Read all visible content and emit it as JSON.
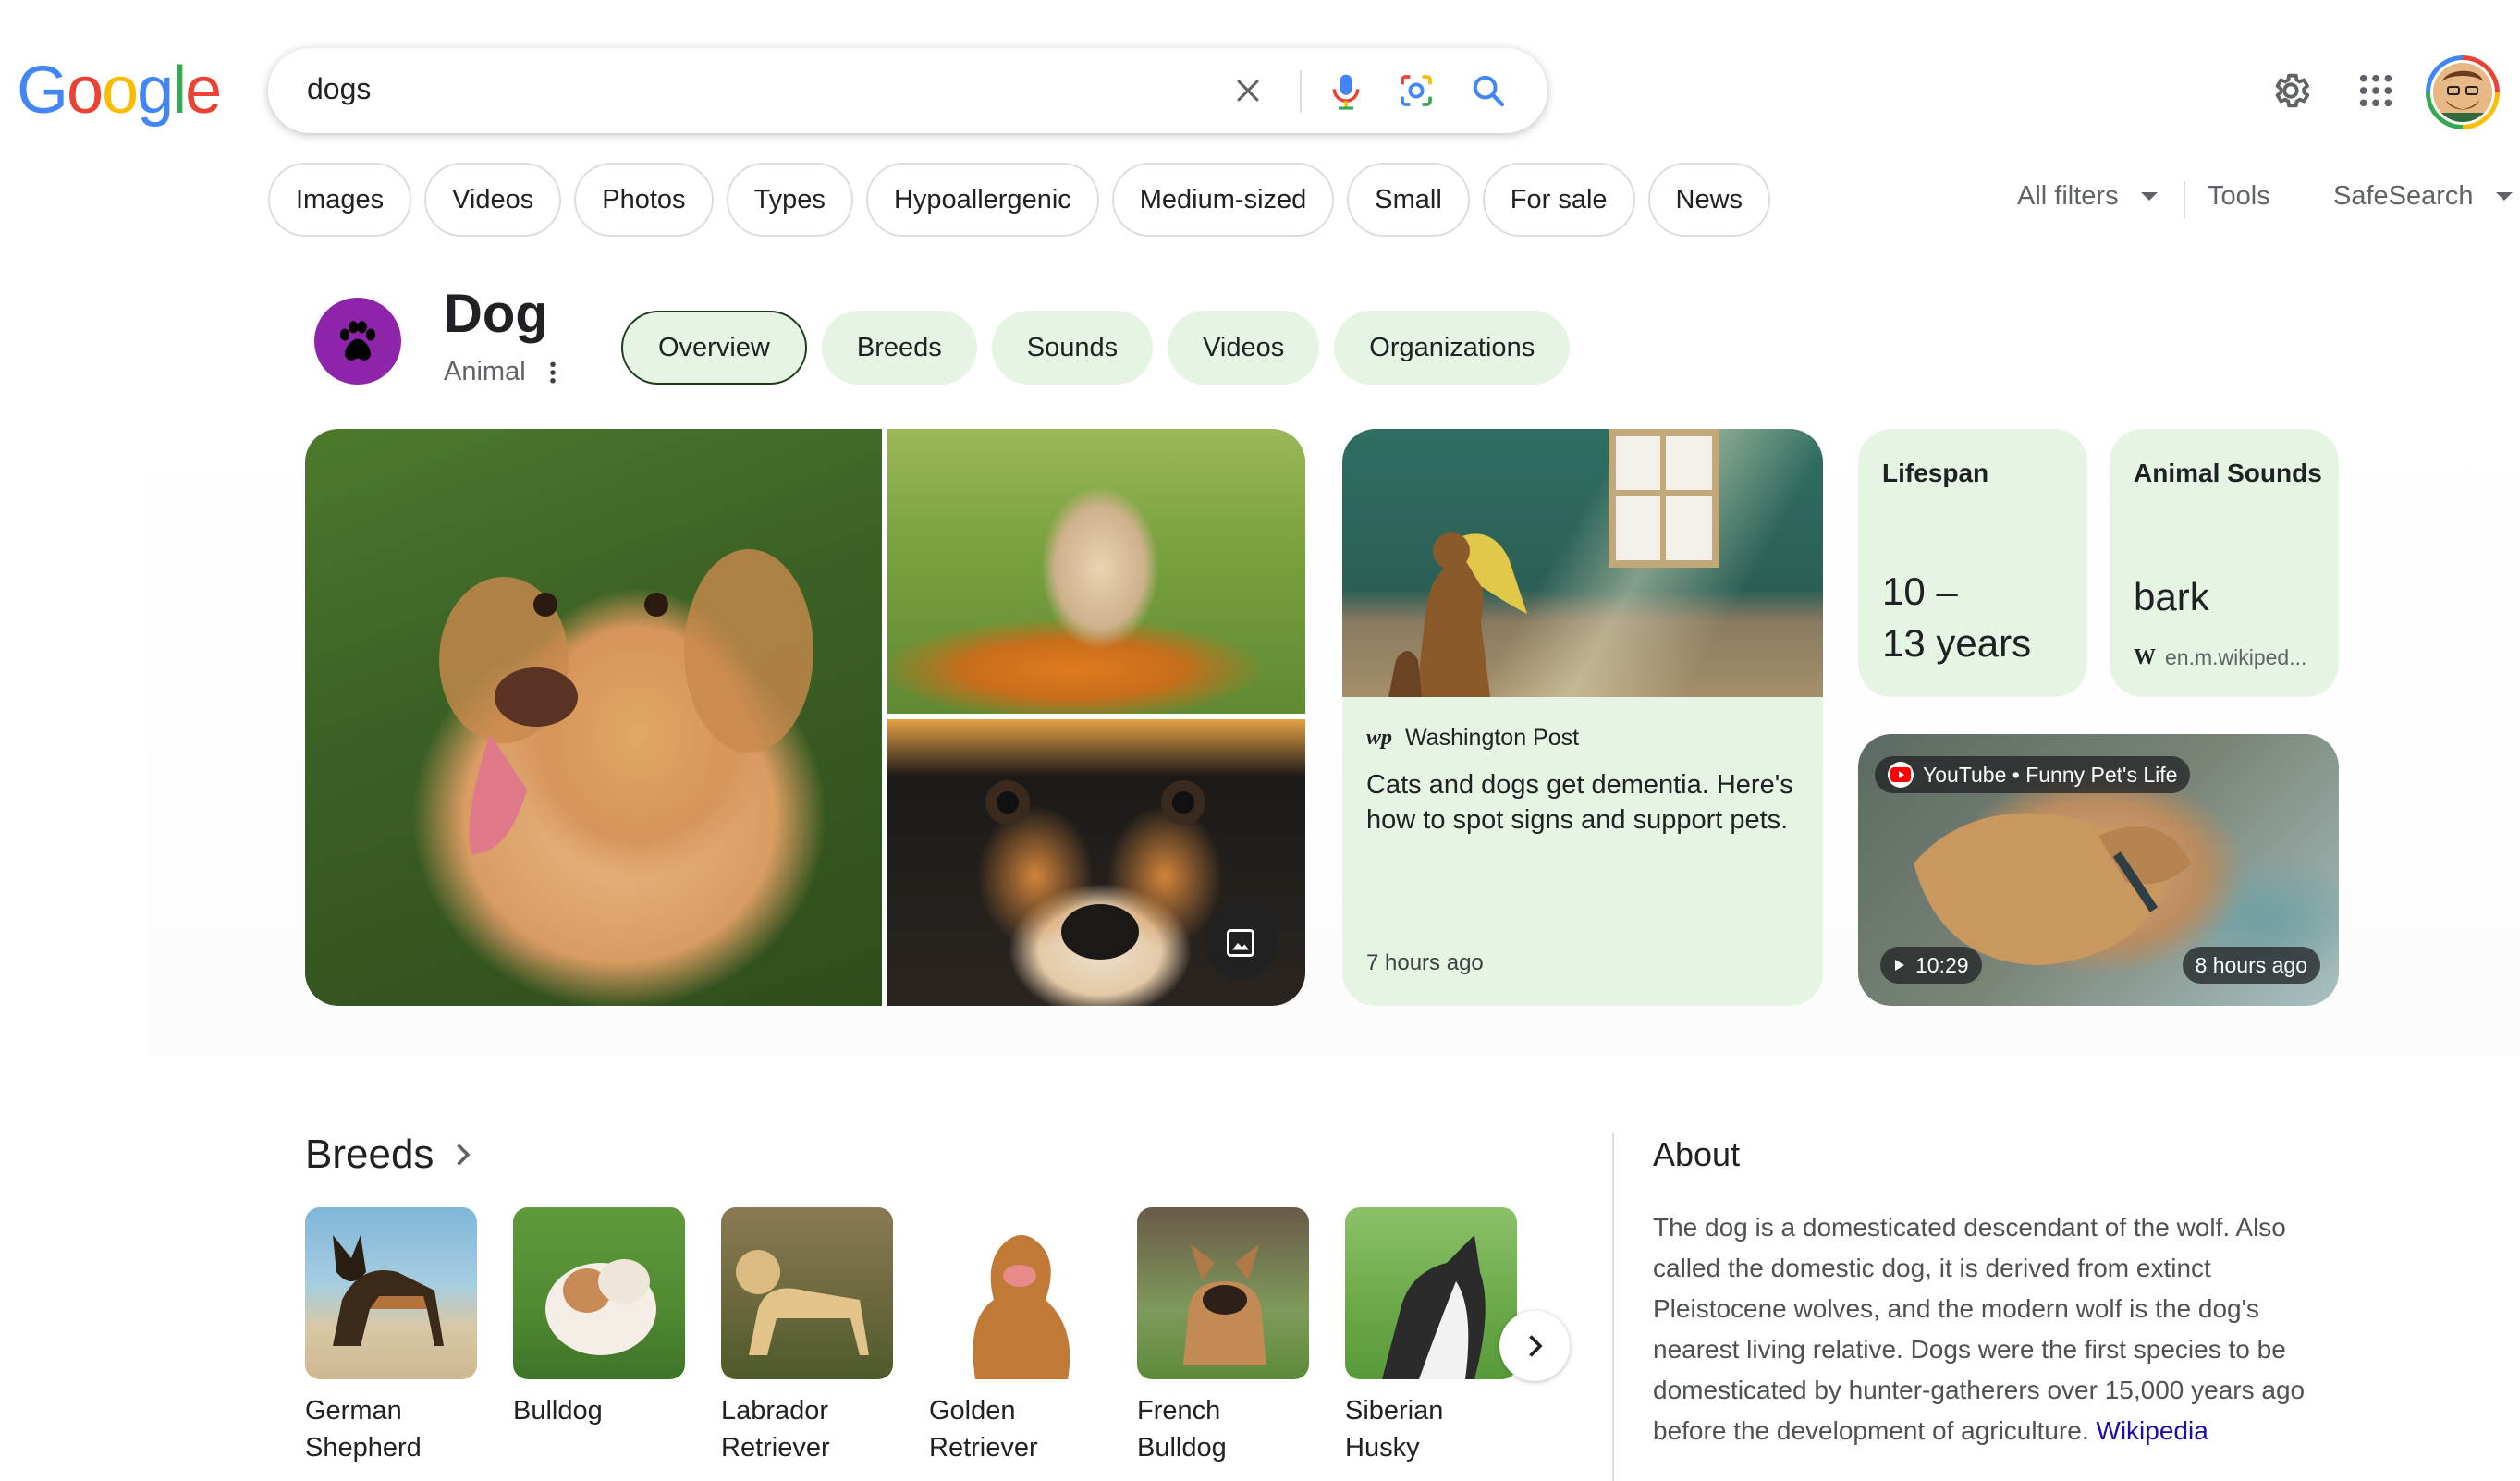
{
  "logo": {
    "letters": [
      "G",
      "o",
      "o",
      "g",
      "l",
      "e"
    ]
  },
  "search": {
    "query": "dogs"
  },
  "filters": {
    "chips": [
      "Images",
      "Videos",
      "Photos",
      "Types",
      "Hypoallergenic",
      "Medium-sized",
      "Small",
      "For sale",
      "News"
    ],
    "all_filters": "All filters",
    "tools": "Tools",
    "safesearch": "SafeSearch"
  },
  "entity": {
    "title": "Dog",
    "subtitle": "Animal",
    "tabs": [
      "Overview",
      "Breeds",
      "Sounds",
      "Videos",
      "Organizations"
    ],
    "active_tab": "Overview"
  },
  "news": {
    "source_logo": "wp",
    "source": "Washington Post",
    "headline": "Cats and dogs get dementia. Here's how to spot signs and support pets.",
    "time": "7 hours ago"
  },
  "lifespan": {
    "label": "Lifespan",
    "line1": "10 –",
    "line2": "13 years"
  },
  "sounds": {
    "label": "Animal Sounds",
    "value": "bark",
    "source": "en.m.wikiped..."
  },
  "video": {
    "channel": "YouTube • Funny Pet's Life",
    "duration": "10:29",
    "time": "8 hours ago"
  },
  "breeds": {
    "title": "Breeds",
    "items": [
      {
        "line1": "German",
        "line2": "Shepherd"
      },
      {
        "line1": "Bulldog",
        "line2": ""
      },
      {
        "line1": "Labrador",
        "line2": "Retriever"
      },
      {
        "line1": "Golden",
        "line2": "Retriever"
      },
      {
        "line1": "French",
        "line2": "Bulldog"
      },
      {
        "line1": "Siberian",
        "line2": "Husky"
      }
    ]
  },
  "about": {
    "title": "About",
    "text": "The dog is a domesticated descendant of the wolf. Also called the domestic dog, it is derived from extinct Pleistocene wolves, and the modern wolf is the dog's nearest living relative. Dogs were the first species to be domesticated by hunter-gatherers over 15,000 years ago before the development of agriculture.",
    "link": "Wikipedia"
  },
  "colors": {
    "accent_green": "#e6f4e3",
    "link": "#1a0dab",
    "icon_purple": "#8e24aa"
  }
}
